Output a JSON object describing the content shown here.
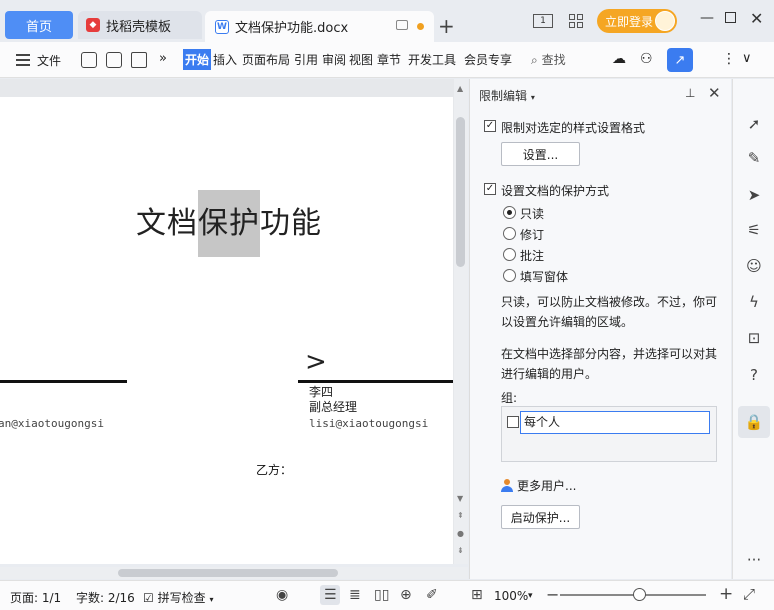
{
  "tabs": {
    "home": "首页",
    "template": "找稻壳模板",
    "document": "文档保护功能.docx"
  },
  "titlebar": {
    "window_badge": "1",
    "login": "立即登录"
  },
  "menu": {
    "file": "文件",
    "items": [
      "开始",
      "插入",
      "页面布局",
      "引用",
      "审阅",
      "视图",
      "章节",
      "开发工具",
      "会员专享"
    ],
    "search": "查找"
  },
  "document": {
    "title_pre": "文档",
    "title_hl": "保护",
    "title_post": "功能",
    "email_left": "an@xiaotougongsi",
    "person_name": "李四",
    "person_title": "副总经理",
    "email_right": "lisi@xiaotougongsi",
    "party": "乙方："
  },
  "panel": {
    "title": "限制编辑",
    "restrict_format_label": "限制对选定的样式设置格式",
    "settings_button": "设置...",
    "protect_label": "设置文档的保护方式",
    "options": [
      "只读",
      "修订",
      "批注",
      "填写窗体"
    ],
    "selected_option": "只读",
    "desc1": "只读，可以防止文档被修改。不过，你可以设置允许编辑的区域。",
    "desc2": "在文档中选择部分内容，并选择可以对其进行编辑的用户。",
    "group_label": "组:",
    "group_everyone": "每个人",
    "more_users": "更多用户...",
    "start_protect": "启动保护..."
  },
  "status": {
    "page": "页面: 1/1",
    "words": "字数: 2/16",
    "spell": "拼写检查",
    "zoom": "100%",
    "zoom_level_percent": 100
  },
  "colors": {
    "accent": "#3b7cf0",
    "login": "#f5a623",
    "highlight": "#c6c6c6"
  }
}
